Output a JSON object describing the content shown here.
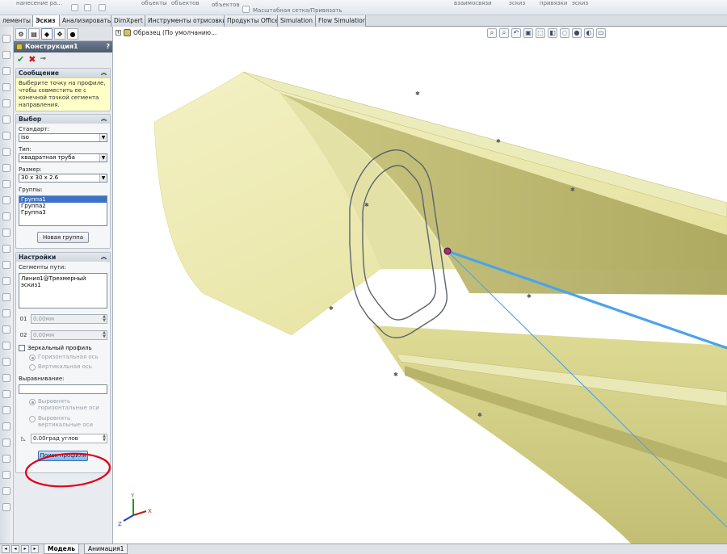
{
  "ribbon": {
    "items": [
      "нанесение ра...",
      "объекты",
      "объектов",
      "объектов",
      "Масштабная сетка/Привязать",
      "взаимосвязи",
      "эскиз",
      "привязки",
      "эскиз"
    ]
  },
  "tabs": [
    {
      "label": "лементы"
    },
    {
      "label": "Эскиз"
    },
    {
      "label": "Анализировать"
    },
    {
      "label": "DimXpert"
    },
    {
      "label": "Инструменты отрисовки"
    },
    {
      "label": "Продукты Office"
    },
    {
      "label": "Simulation"
    },
    {
      "label": "Flow Simulation"
    }
  ],
  "pm": {
    "title": "Конструкция1",
    "help": "?",
    "message": {
      "header": "Сообщение",
      "text": "Выберите точку на профиле, чтобы совместить ее с конечной точкой сегмента направления."
    },
    "selection": {
      "header": "Выбор",
      "standard_label": "Стандарт:",
      "standard_value": "iso",
      "type_label": "Тип:",
      "type_value": "квадратная труба",
      "size_label": "Размер:",
      "size_value": "30 x 30 x 2.6",
      "groups_label": "Группы:",
      "groups": [
        "Группа1",
        "Группа2",
        "Группа3"
      ],
      "new_group_button": "Новая группа"
    },
    "settings": {
      "header": "Настройки",
      "path_segments_label": "Сегменты пути:",
      "path_segments_value": "Линия1@Трехмерный эскиз1",
      "offset1_icon": "01",
      "offset1": "0.00мм",
      "offset2_icon": "02",
      "offset2": "0.00мм",
      "mirror_label": "Зеркальный профиль",
      "horizontal_axis": "Горизонтальная ось",
      "vertical_axis": "Вертикальная ось",
      "align_label": "Выравнивание:",
      "align_horizontal": "Выровнять горизонтальные оси",
      "align_vertical": "Выровнять вертикальные оси",
      "angle_value": "0.00град углов",
      "locate_profile_button": "Поиск профиля"
    }
  },
  "viewport": {
    "tree_item": "Образец  (По умолчанию...",
    "colors": {
      "tube": "#e6e39c",
      "tube_dark": "#a6a35a",
      "path_line": "#4da3e8",
      "annotation": "#e0001b"
    }
  },
  "bottom_tabs": [
    {
      "label": "Модель"
    },
    {
      "label": "Анимация1"
    }
  ]
}
